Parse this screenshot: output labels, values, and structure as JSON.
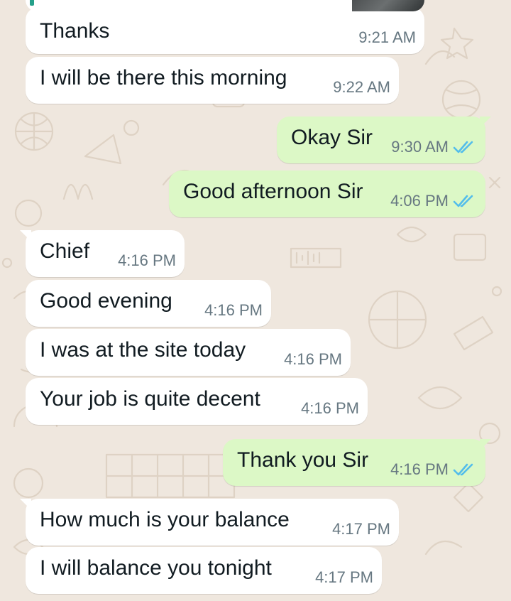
{
  "chat": {
    "quoted_preview": {
      "thumbnail_icon": "image-thumbnail"
    },
    "messages": [
      {
        "direction": "in",
        "text": "Thanks",
        "time": "9:21 AM"
      },
      {
        "direction": "in",
        "text": "I will be there this morning",
        "time": "9:22 AM"
      },
      {
        "direction": "out",
        "text": "Okay Sir",
        "time": "9:30 AM",
        "status_icon": "double-check-read-icon"
      },
      {
        "direction": "out",
        "text": "Good afternoon Sir",
        "time": "4:06 PM",
        "status_icon": "double-check-read-icon"
      },
      {
        "direction": "in",
        "text": "Chief",
        "time": "4:16 PM"
      },
      {
        "direction": "in",
        "text": "Good evening",
        "time": "4:16 PM"
      },
      {
        "direction": "in",
        "text": "I was at the site today",
        "time": "4:16 PM"
      },
      {
        "direction": "in",
        "text": "Your job is quite decent",
        "time": "4:16 PM"
      },
      {
        "direction": "out",
        "text": "Thank you Sir",
        "time": "4:16 PM",
        "status_icon": "double-check-read-icon"
      },
      {
        "direction": "in",
        "text": "How much is your balance",
        "time": "4:17 PM"
      },
      {
        "direction": "in",
        "text": "I will balance you tonight",
        "time": "4:17 PM"
      }
    ]
  },
  "colors": {
    "wallpaper": "#efe7de",
    "incoming_bubble": "#ffffff",
    "outgoing_bubble": "#dcf8c6",
    "timestamp": "#667781",
    "read_ticks": "#53bdeb"
  }
}
